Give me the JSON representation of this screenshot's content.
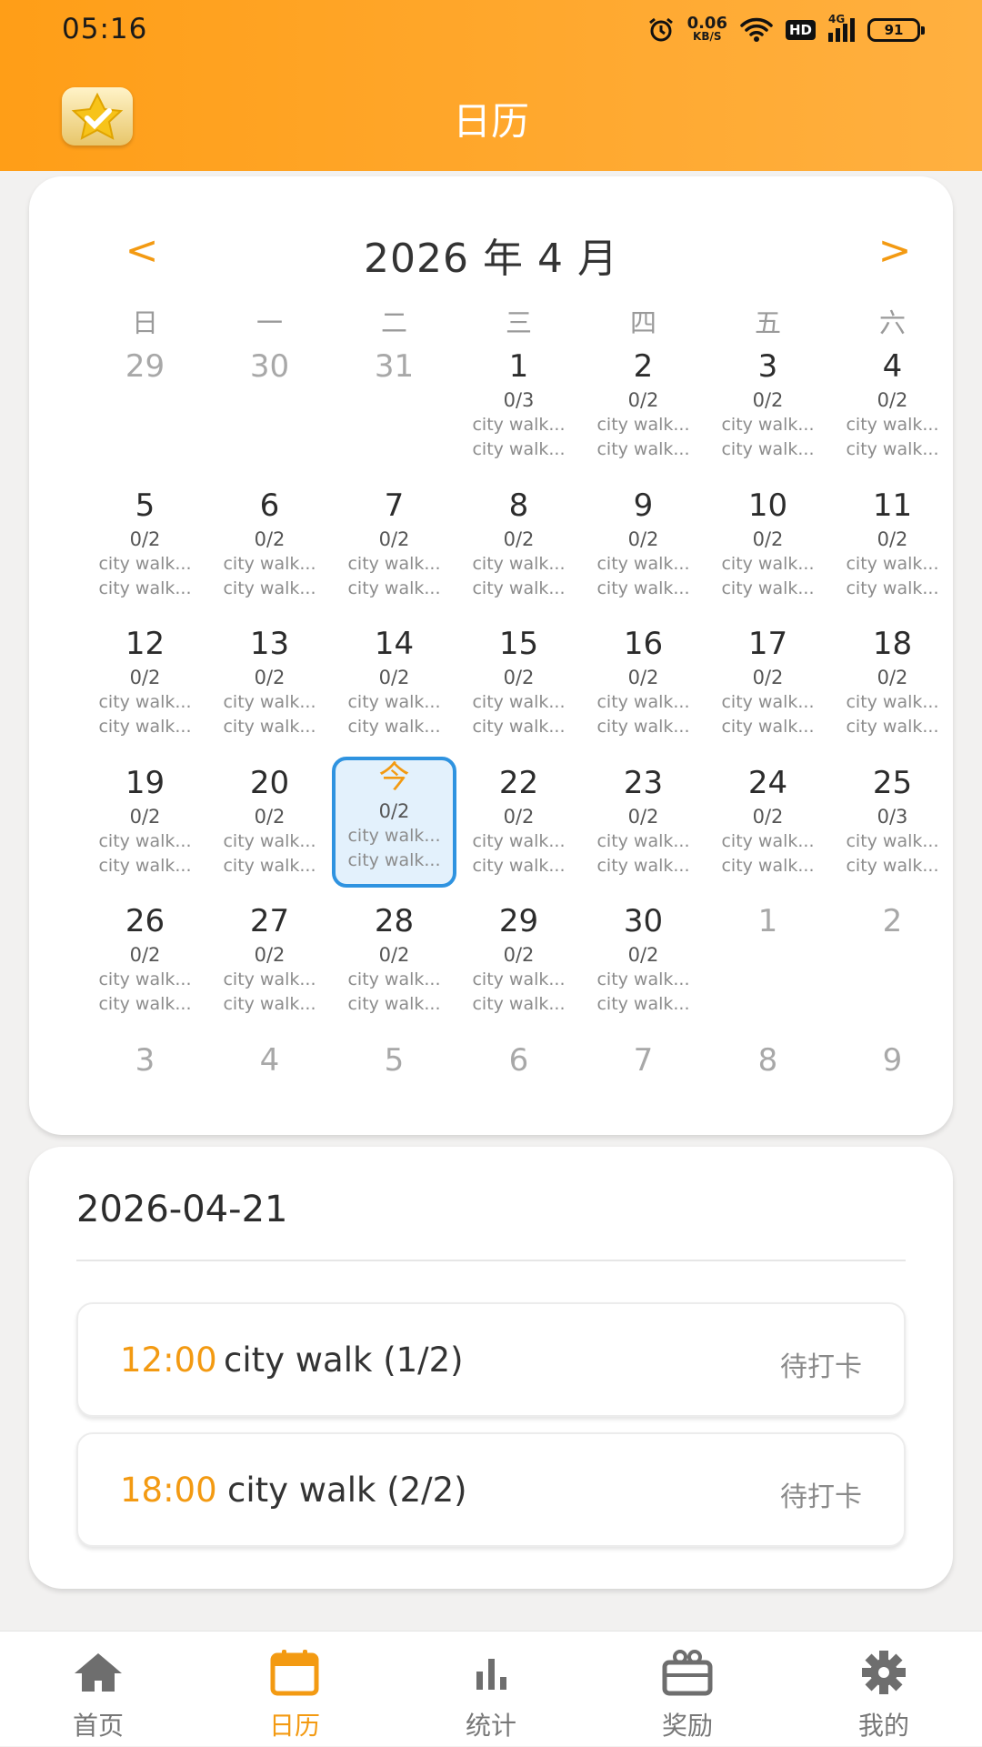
{
  "status_bar": {
    "time": "05:16",
    "net_speed": "0.06",
    "net_unit": "KB/S",
    "hd": "HD",
    "network": "4G",
    "battery": "91"
  },
  "app": {
    "title": "日历",
    "logo_icon": "star-check-icon"
  },
  "calendar": {
    "prev_label": "<",
    "next_label": ">",
    "month_label": "2026 年 4 月",
    "weekdays": [
      "日",
      "一",
      "二",
      "三",
      "四",
      "五",
      "六"
    ],
    "event_text": "city walk...",
    "days": [
      {
        "day": "29",
        "dim": true
      },
      {
        "day": "30",
        "dim": true
      },
      {
        "day": "31",
        "dim": true
      },
      {
        "day": "1",
        "count": "0/3",
        "events": 2
      },
      {
        "day": "2",
        "count": "0/2",
        "events": 2
      },
      {
        "day": "3",
        "count": "0/2",
        "events": 2
      },
      {
        "day": "4",
        "count": "0/2",
        "events": 2
      },
      {
        "day": "5",
        "count": "0/2",
        "events": 2
      },
      {
        "day": "6",
        "count": "0/2",
        "events": 2
      },
      {
        "day": "7",
        "count": "0/2",
        "events": 2
      },
      {
        "day": "8",
        "count": "0/2",
        "events": 2
      },
      {
        "day": "9",
        "count": "0/2",
        "events": 2
      },
      {
        "day": "10",
        "count": "0/2",
        "events": 2
      },
      {
        "day": "11",
        "count": "0/2",
        "events": 2
      },
      {
        "day": "12",
        "count": "0/2",
        "events": 2
      },
      {
        "day": "13",
        "count": "0/2",
        "events": 2
      },
      {
        "day": "14",
        "count": "0/2",
        "events": 2
      },
      {
        "day": "15",
        "count": "0/2",
        "events": 2
      },
      {
        "day": "16",
        "count": "0/2",
        "events": 2
      },
      {
        "day": "17",
        "count": "0/2",
        "events": 2
      },
      {
        "day": "18",
        "count": "0/2",
        "events": 2
      },
      {
        "day": "19",
        "count": "0/2",
        "events": 2
      },
      {
        "day": "20",
        "count": "0/2",
        "events": 2
      },
      {
        "day": "今",
        "count": "0/2",
        "events": 2,
        "today": true
      },
      {
        "day": "22",
        "count": "0/2",
        "events": 2
      },
      {
        "day": "23",
        "count": "0/2",
        "events": 2
      },
      {
        "day": "24",
        "count": "0/2",
        "events": 2
      },
      {
        "day": "25",
        "count": "0/3",
        "events": 2
      },
      {
        "day": "26",
        "count": "0/2",
        "events": 2
      },
      {
        "day": "27",
        "count": "0/2",
        "events": 2
      },
      {
        "day": "28",
        "count": "0/2",
        "events": 2
      },
      {
        "day": "29",
        "count": "0/2",
        "events": 2
      },
      {
        "day": "30",
        "count": "0/2",
        "events": 2
      },
      {
        "day": "1",
        "dim": true
      },
      {
        "day": "2",
        "dim": true
      },
      {
        "day": "3",
        "dim": true
      },
      {
        "day": "4",
        "dim": true
      },
      {
        "day": "5",
        "dim": true
      },
      {
        "day": "6",
        "dim": true
      },
      {
        "day": "7",
        "dim": true
      },
      {
        "day": "8",
        "dim": true
      },
      {
        "day": "9",
        "dim": true
      }
    ]
  },
  "detail": {
    "date": "2026-04-21",
    "tasks": [
      {
        "time": "12:00",
        "name": "city walk (1/2)",
        "status": "待打卡"
      },
      {
        "time": "18:00",
        "name": "city walk (2/2)",
        "status": "待打卡"
      }
    ]
  },
  "tabs": [
    {
      "label": "首页",
      "icon": "home-icon"
    },
    {
      "label": "日历",
      "icon": "calendar-icon",
      "active": true
    },
    {
      "label": "统计",
      "icon": "bar-chart-icon"
    },
    {
      "label": "奖励",
      "icon": "gift-box-icon"
    },
    {
      "label": "我的",
      "icon": "gear-icon"
    }
  ],
  "colors": {
    "accent": "#f39a12",
    "today_border": "#2f93e0",
    "today_bg": "#e3f1fc",
    "header_from": "#ff9e17",
    "header_to": "#ffb040"
  }
}
